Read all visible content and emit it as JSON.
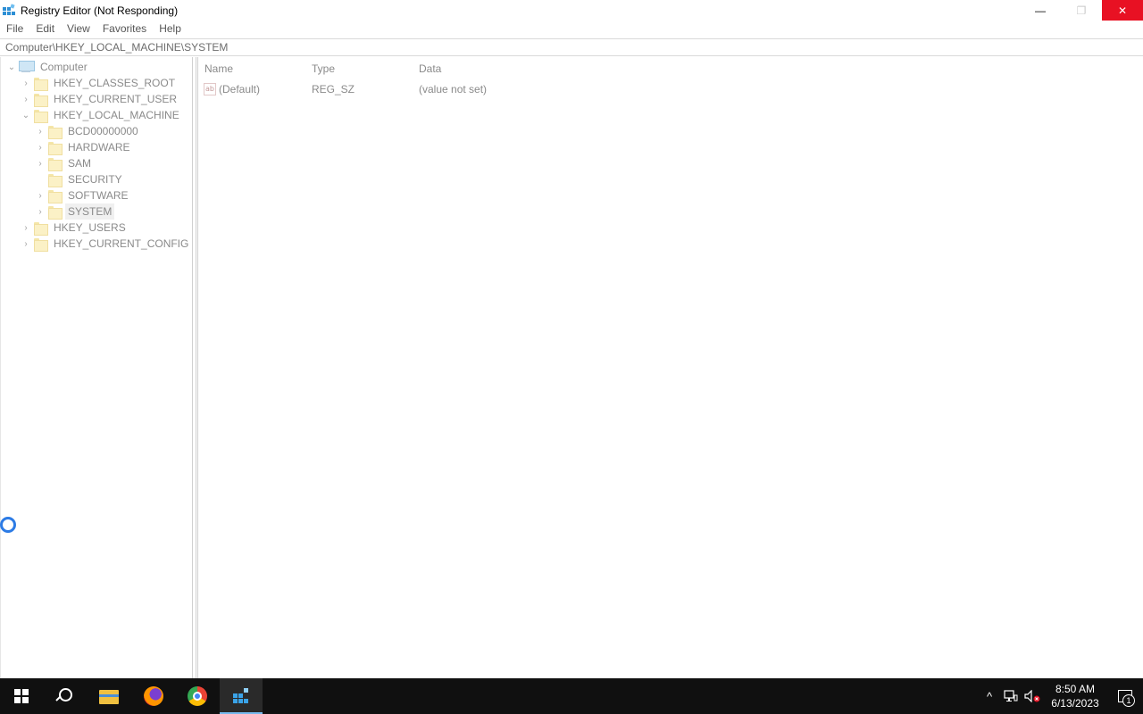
{
  "window": {
    "title": "Registry Editor (Not Responding)",
    "minimize_glyph": "—",
    "restore_glyph": "❐",
    "close_glyph": "✕"
  },
  "menu": [
    "File",
    "Edit",
    "View",
    "Favorites",
    "Help"
  ],
  "address": "Computer\\HKEY_LOCAL_MACHINE\\SYSTEM",
  "tree": {
    "root": "Computer",
    "items": [
      {
        "label": "HKEY_CLASSES_ROOT",
        "depth": 1,
        "expander": "›"
      },
      {
        "label": "HKEY_CURRENT_USER",
        "depth": 1,
        "expander": "›"
      },
      {
        "label": "HKEY_LOCAL_MACHINE",
        "depth": 1,
        "expander": "⌄"
      },
      {
        "label": "BCD00000000",
        "depth": 2,
        "expander": "›"
      },
      {
        "label": "HARDWARE",
        "depth": 2,
        "expander": "›"
      },
      {
        "label": "SAM",
        "depth": 2,
        "expander": "›"
      },
      {
        "label": "SECURITY",
        "depth": 2,
        "expander": ""
      },
      {
        "label": "SOFTWARE",
        "depth": 2,
        "expander": "›"
      },
      {
        "label": "SYSTEM",
        "depth": 2,
        "expander": "›",
        "selected": true
      },
      {
        "label": "HKEY_USERS",
        "depth": 1,
        "expander": "›"
      },
      {
        "label": "HKEY_CURRENT_CONFIG",
        "depth": 1,
        "expander": "›"
      }
    ]
  },
  "list": {
    "columns": [
      "Name",
      "Type",
      "Data"
    ],
    "rows": [
      {
        "icon": "ab",
        "name": "(Default)",
        "type": "REG_SZ",
        "data": "(value not set)"
      }
    ]
  },
  "taskbar": {
    "time": "8:50 AM",
    "date": "6/13/2023",
    "notification_count": "1",
    "tray_chevron": "^",
    "apps": [
      "start",
      "search",
      "file-explorer",
      "firefox",
      "chrome",
      "registry-editor"
    ]
  },
  "colors": {
    "close_button": "#e81123",
    "taskbar": "#101010",
    "busy_cursor": "#2c7be5"
  }
}
